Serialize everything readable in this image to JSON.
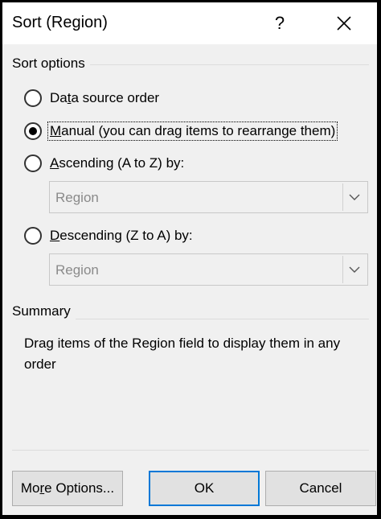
{
  "window": {
    "title": "Sort (Region)",
    "help_label": "?"
  },
  "sort_options": {
    "group_label": "Sort options",
    "options": [
      {
        "label_pre": "Da",
        "label_u": "t",
        "label_post": "a source order",
        "checked": false
      },
      {
        "label_pre": "",
        "label_u": "M",
        "label_post": "anual (you can drag items to rearrange them)",
        "checked": true
      },
      {
        "label_pre": "",
        "label_u": "A",
        "label_post": "scending (A to Z) by:",
        "checked": false
      },
      {
        "label_pre": "",
        "label_u": "D",
        "label_post": "escending (Z to A) by:",
        "checked": false
      }
    ],
    "ascending_field": "Region",
    "descending_field": "Region"
  },
  "summary": {
    "group_label": "Summary",
    "text": "Drag items of the Region field to display them in any order"
  },
  "buttons": {
    "more_pre": "Mo",
    "more_u": "r",
    "more_post": "e Options...",
    "ok": "OK",
    "cancel": "Cancel"
  },
  "colors": {
    "dialog_bg": "#f0f0f0",
    "titlebar_bg": "#ffffff",
    "default_button_border": "#0078d7"
  }
}
